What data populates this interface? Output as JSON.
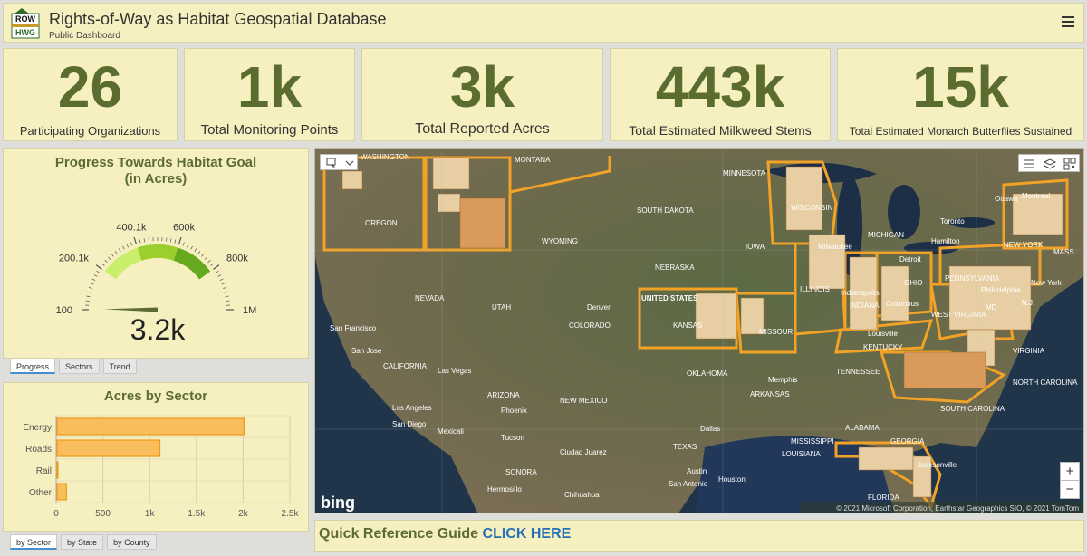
{
  "header": {
    "logo_text": "ROW HWG",
    "title": "Rights-of-Way as Habitat Geospatial Database",
    "subtitle": "Public Dashboard",
    "menu_icon": "hamburger-icon"
  },
  "kpis": [
    {
      "value": "26",
      "label": "Participating Organizations"
    },
    {
      "value": "1k",
      "label": "Total Monitoring Points"
    },
    {
      "value": "3k",
      "label": "Total Reported Acres"
    },
    {
      "value": "443k",
      "label": "Total Estimated Milkweed Stems"
    },
    {
      "value": "15k",
      "label": "Total Estimated Monarch Butterflies Sustained"
    }
  ],
  "gauge": {
    "title_line1": "Progress Towards Habitat Goal",
    "title_line2": "(in Acres)",
    "value_label": "3.2k",
    "value": 3200,
    "min": 100,
    "max": 1000000,
    "tick_labels": [
      "100",
      "200.1k",
      "400.1k",
      "600k",
      "800k",
      "1M"
    ],
    "band_colors": [
      "#c9ee6c",
      "#9ccf2e",
      "#66a81e"
    ],
    "tabs": [
      "Progress",
      "Sectors",
      "Trend"
    ],
    "active_tab": "Progress"
  },
  "chart_data": {
    "type": "bar",
    "orientation": "horizontal",
    "title": "Acres by Sector",
    "categories": [
      "Energy",
      "Roads",
      "Rail",
      "Other"
    ],
    "values": [
      2000,
      1100,
      5,
      100
    ],
    "xlim": [
      0,
      2500
    ],
    "x_ticks": [
      "0",
      "500",
      "1k",
      "1.5k",
      "2k",
      "2.5k"
    ],
    "grid": true,
    "bar_color": "#f9bd5c",
    "bar_edge": "#ee9b1b"
  },
  "bar_tabs": {
    "items": [
      "by Sector",
      "by State",
      "by County"
    ],
    "active": "by Sector"
  },
  "map": {
    "labels": [
      "WASHINGTON",
      "MONTANA",
      "MINNESOTA",
      "Ottawa",
      "Montreal",
      "OREGON",
      "SOUTH DAKOTA",
      "WISCONSIN",
      "Toronto",
      "WYOMING",
      "IOWA",
      "MICHIGAN",
      "Hamilton",
      "NEW YORK",
      "MASS.",
      "NEBRASKA",
      "Detroit",
      "Milwaukee",
      "PENNSYLVANIA",
      "Philadelphia",
      "New York",
      "NEVADA",
      "UNITED STATES",
      "UTAH",
      "Denver",
      "ILLINOIS",
      "Indianapolis",
      "OHIO",
      "Columbus",
      "N.J.",
      "San Francisco",
      "COLORADO",
      "KANSAS",
      "MISSOURI",
      "INDIANA",
      "WEST VIRGINIA",
      "MD",
      "San Jose",
      "CALIFORNIA",
      "Las Vegas",
      "OKLAHOMA",
      "Louisville",
      "KENTUCKY",
      "VIRGINIA",
      "ARIZONA",
      "NEW MEXICO",
      "TENNESSEE",
      "Memphis",
      "NORTH CAROLINA",
      "Los Angeles",
      "Phoenix",
      "ARKANSAS",
      "SOUTH CAROLINA",
      "San Diego",
      "Mexicali",
      "Tucson",
      "Dallas",
      "ALABAMA",
      "Ciudad Juarez",
      "TEXAS",
      "MISSISSIPPI",
      "GEORGIA",
      "SONORA",
      "LOUISIANA",
      "Austin",
      "Houston",
      "Jacksonville",
      "San Antonio",
      "Hermosillo",
      "Chihuahua",
      "FLORIDA"
    ],
    "basemap_logo": "bing",
    "attribution": "© 2021 Microsoft Corporation, Earthstar Geographics SIO, © 2021 TomTom",
    "tools": [
      "select-icon",
      "chevron-down-icon",
      "legend-icon",
      "layers-icon",
      "qr-icon"
    ],
    "zoom_in": "+",
    "zoom_out": "−"
  },
  "quick_ref": {
    "text": "Quick Reference Guide",
    "link": "CLICK HERE"
  }
}
